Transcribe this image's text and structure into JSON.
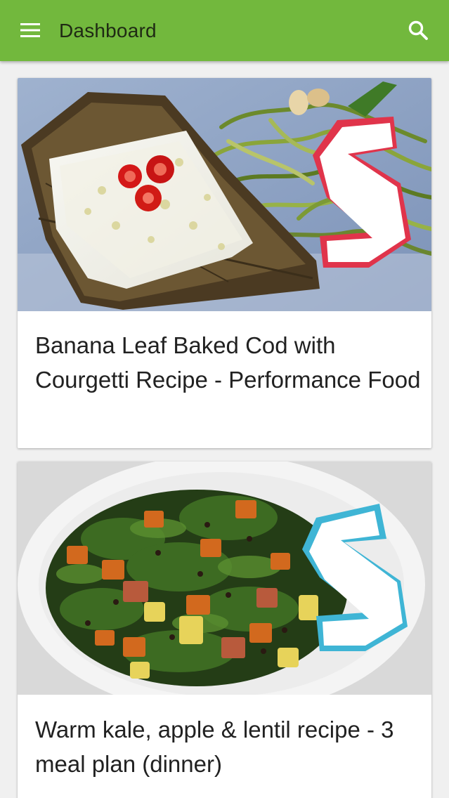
{
  "appbar": {
    "title": "Dashboard",
    "menu_icon": "hamburger-menu-icon",
    "search_icon": "search-icon",
    "color": "#72b83d"
  },
  "feed": {
    "cards": [
      {
        "title": "Banana Leaf Baked Cod with Courgetti Recipe - Performance Food",
        "image": "baked-cod-banana-leaf-photo",
        "logo_accent": "#e0344b"
      },
      {
        "title": "Warm kale, apple & lentil recipe - 3 meal plan (dinner)",
        "image": "kale-apple-lentil-bowl-photo",
        "logo_accent": "#3fb5d5"
      }
    ]
  }
}
